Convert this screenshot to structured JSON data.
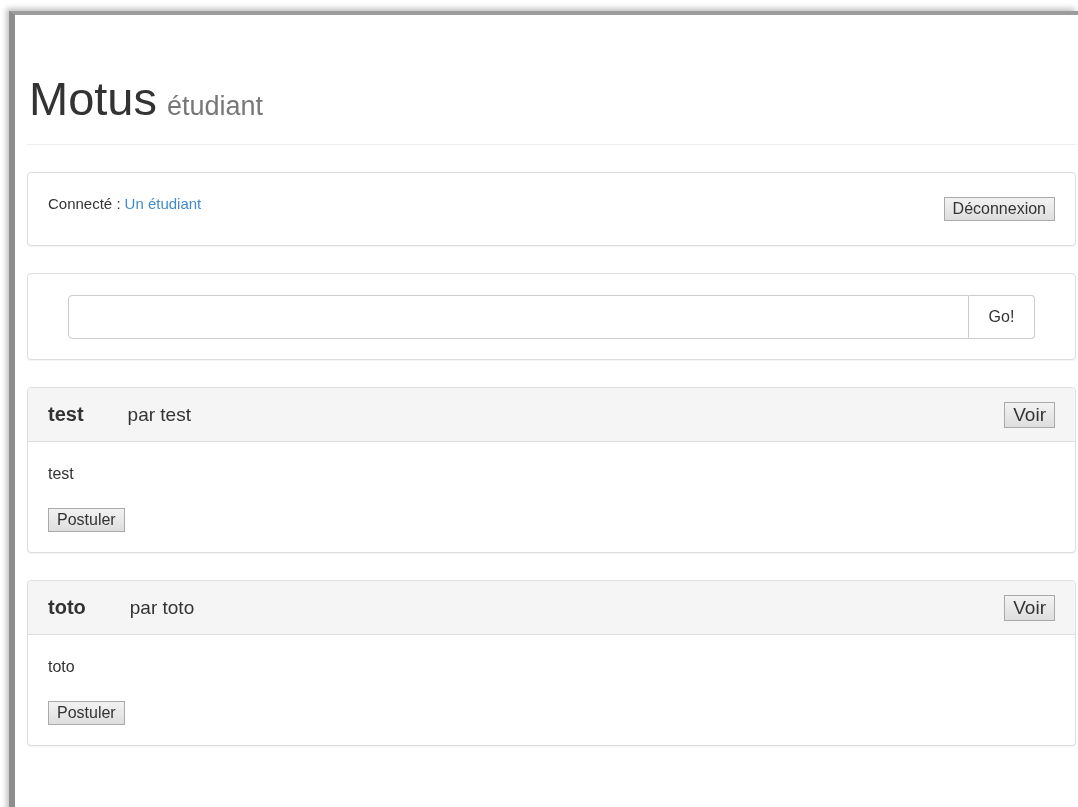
{
  "header": {
    "title": "Motus",
    "subtitle": "étudiant"
  },
  "session": {
    "label": "Connecté :",
    "user": "Un étudiant",
    "logout_button": "Déconnexion"
  },
  "search": {
    "button": "Go!"
  },
  "offers": [
    {
      "title": "test",
      "author": "par test",
      "view_button": "Voir",
      "description": "test",
      "apply_button": "Postuler"
    },
    {
      "title": "toto",
      "author": "par toto",
      "view_button": "Voir",
      "description": "toto",
      "apply_button": "Postuler"
    }
  ]
}
